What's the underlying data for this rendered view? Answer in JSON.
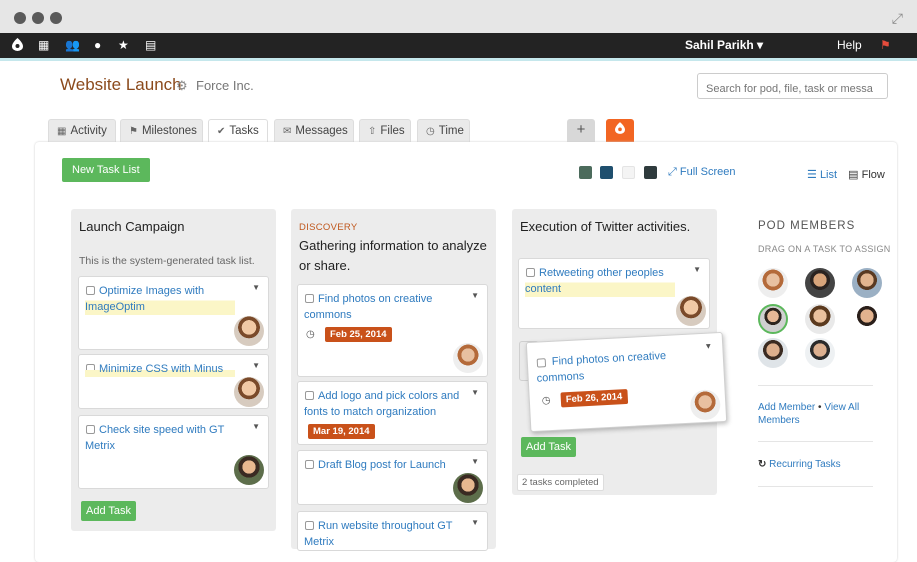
{
  "nav": {
    "icons": [
      "logo-icon",
      "film-icon",
      "people-icon",
      "person-icon",
      "star-icon",
      "calendar-icon"
    ],
    "user": "Sahil Parikh",
    "help": "Help"
  },
  "project": {
    "title": "Website Launch",
    "company": "Force Inc.",
    "search_placeholder": "Search for pod, file, task or messa"
  },
  "tabs": [
    {
      "label": "Activity"
    },
    {
      "label": "Milestones"
    },
    {
      "label": "Tasks"
    },
    {
      "label": "Messages"
    },
    {
      "label": "Files"
    },
    {
      "label": "Time"
    }
  ],
  "toolbar": {
    "new_task_list": "New Task List",
    "full_screen": "Full Screen",
    "list": "List",
    "flow": "Flow",
    "swatches": [
      "#4c6b5c",
      "#1f4f6e",
      "#f4f4f4",
      "#2f3b3d"
    ]
  },
  "columns": [
    {
      "title": "Launch Campaign",
      "subtitle": "This is the system-generated task list.",
      "cards": [
        {
          "title": "Optimize Images with ImageOptim"
        },
        {
          "title": "Minimize CSS with Minus"
        },
        {
          "title": "Check site speed with GT Metrix"
        }
      ],
      "add_task": "Add Task"
    },
    {
      "milestone": "DISCOVERY",
      "title": "Gathering information to analyze or share.",
      "cards": [
        {
          "title": "Find photos on creative commons",
          "date": "Feb 25, 2014"
        },
        {
          "title": "Add logo and pick colors and fonts to match organization",
          "date": "Mar 19, 2014"
        },
        {
          "title": "Draft Blog post for Launch"
        },
        {
          "title": "Run website throughout GT Metrix"
        }
      ]
    },
    {
      "title": "Execution of Twitter activities.",
      "cards": [
        {
          "title": "Retweeting other peoples content"
        }
      ],
      "add_task": "Add Task",
      "completed": "2 tasks completed"
    }
  ],
  "dragging_card": {
    "title": "Find photos on creative commons",
    "date": "Feb 26, 2014"
  },
  "pod": {
    "heading": "POD MEMBERS",
    "subheading": "DRAG ON A TASK TO ASSIGN",
    "add_member": "Add Member",
    "separator": "•",
    "view_all": "View All Members",
    "recurring": "Recurring Tasks"
  },
  "colors": {
    "accent": "#f26522",
    "link": "#2f7bbf",
    "green": "#5cb85c",
    "date": "#c9511a"
  }
}
